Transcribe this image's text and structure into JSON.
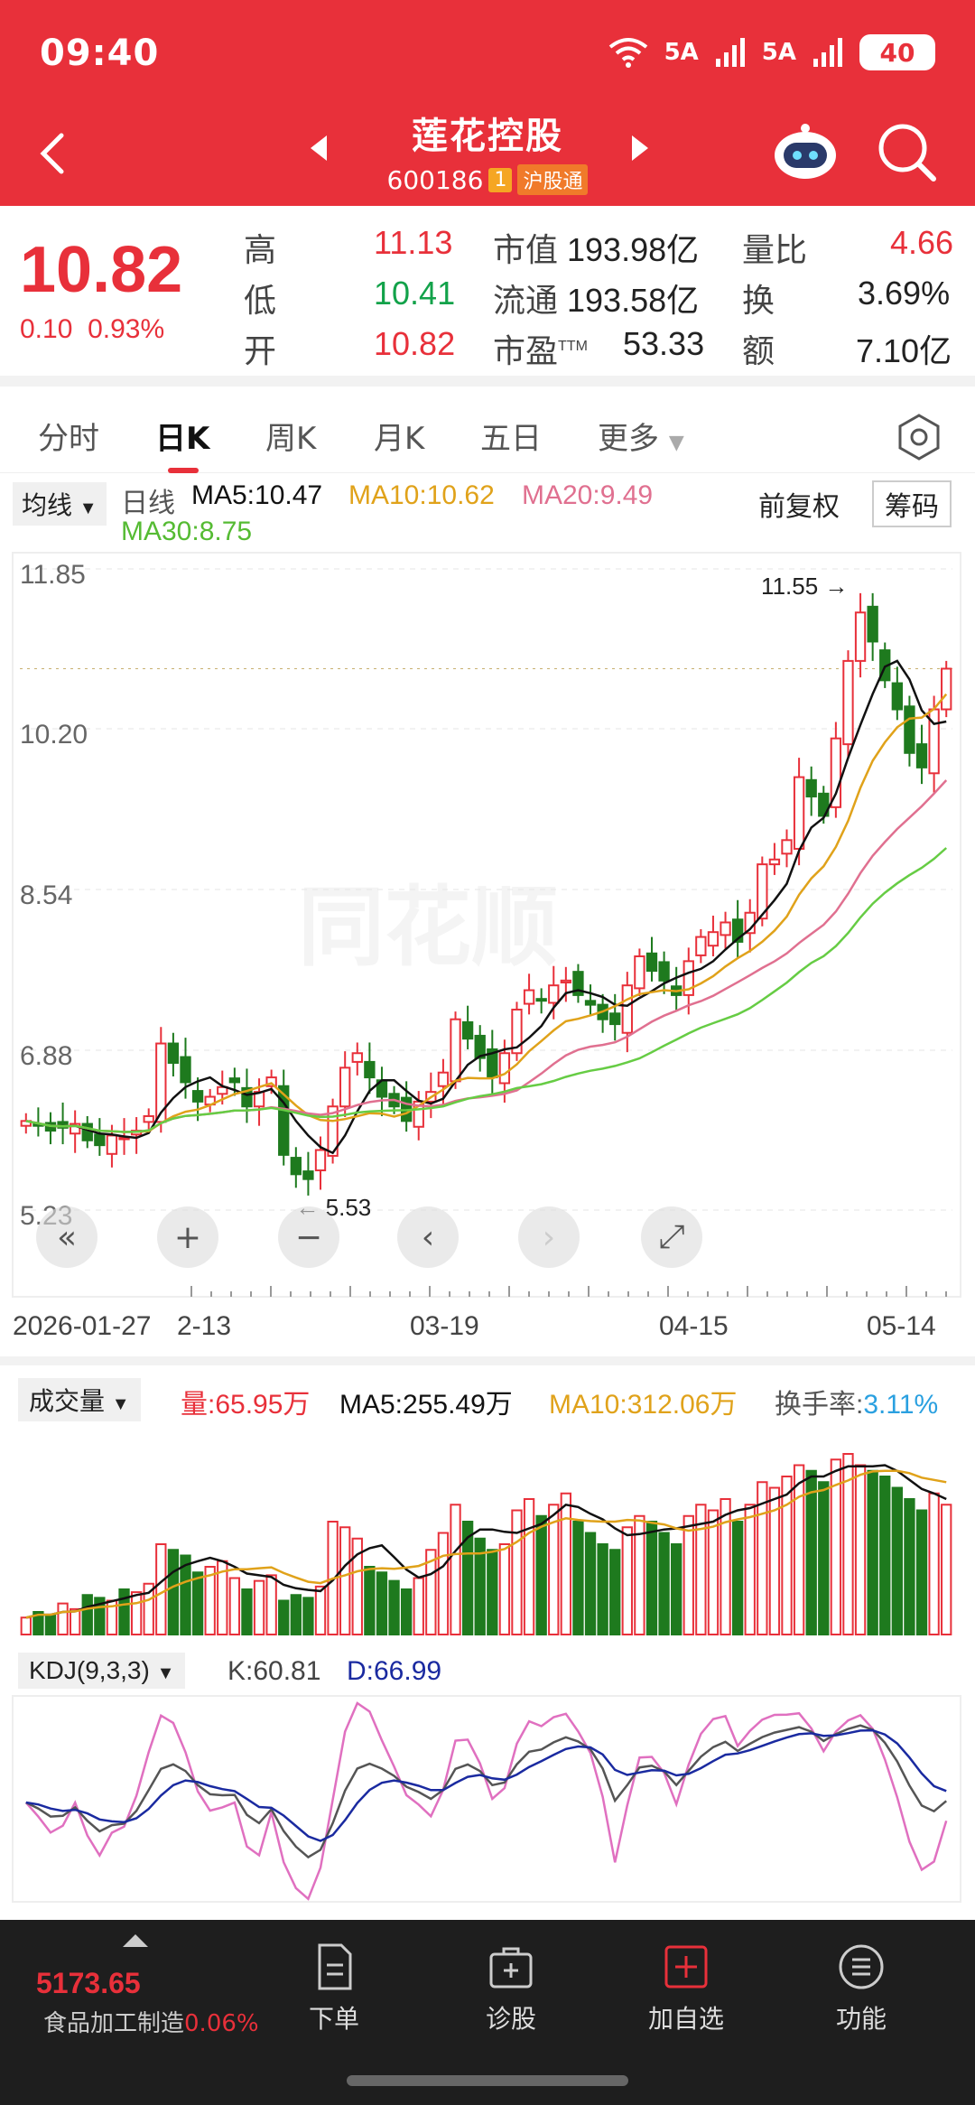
{
  "status": {
    "time": "09:40",
    "signal1": "5A",
    "signal2": "5A",
    "battery": "40"
  },
  "header": {
    "name": "莲花控股",
    "code": "600186",
    "badge_num": "1",
    "badge_text": "沪股通"
  },
  "quote": {
    "price": "10.82",
    "change": "0.10",
    "change_pct": "0.93%",
    "high_label": "高",
    "high": "11.13",
    "low_label": "低",
    "low": "10.41",
    "open_label": "开",
    "open": "10.82",
    "mktcap_label": "市值",
    "mktcap": "193.98亿",
    "float_label": "流通",
    "float": "193.58亿",
    "pe_label": "市盈",
    "pe_sup": "TTM",
    "pe": "53.33",
    "volratio_label": "量比",
    "volratio": "4.66",
    "turnover_label": "换",
    "turnover": "3.69%",
    "amount_label": "额",
    "amount": "7.10亿"
  },
  "tabs": [
    {
      "label": "分时"
    },
    {
      "label": "日K"
    },
    {
      "label": "周K"
    },
    {
      "label": "月K"
    },
    {
      "label": "五日"
    },
    {
      "label": "更多"
    }
  ],
  "ma": {
    "select": "均线",
    "period": "日线",
    "ma5": "MA5:10.47",
    "ma10": "MA10:10.62",
    "ma20": "MA20:9.49",
    "ma30": "MA30:8.75",
    "fuquan": "前复权",
    "chouma": "筹码"
  },
  "chart_data": {
    "type": "candlestick",
    "y_ticks": [
      "11.85",
      "10.20",
      "8.54",
      "6.88",
      "5.23"
    ],
    "ylim": [
      5.23,
      11.85
    ],
    "annotations": {
      "high": "11.55",
      "low": "5.53"
    },
    "x_ticks": [
      "2026-01-27",
      "2-13",
      "03-19",
      "04-15",
      "05-14"
    ],
    "colors": {
      "up": "#e8303a",
      "down": "#1e7a1e",
      "ma5": "#111111",
      "ma10": "#e0a21a",
      "ma20": "#e07090",
      "ma30": "#66cc44"
    },
    "closes": [
      6.15,
      6.1,
      6.05,
      6.08,
      6.12,
      5.95,
      5.9,
      6.0,
      5.98,
      6.05,
      6.2,
      6.95,
      6.75,
      6.55,
      6.35,
      6.4,
      6.5,
      6.55,
      6.3,
      6.45,
      6.6,
      5.8,
      5.6,
      5.55,
      5.85,
      6.3,
      6.7,
      6.85,
      6.6,
      6.4,
      6.3,
      6.15,
      6.35,
      6.45,
      6.65,
      7.2,
      7.0,
      6.8,
      6.6,
      6.85,
      7.3,
      7.5,
      7.4,
      7.55,
      7.6,
      7.45,
      7.35,
      7.2,
      7.15,
      7.55,
      7.85,
      7.7,
      7.6,
      7.45,
      7.8,
      8.05,
      8.1,
      8.2,
      8.0,
      8.3,
      8.8,
      8.85,
      9.05,
      9.7,
      9.5,
      9.3,
      10.1,
      10.9,
      11.4,
      11.1,
      10.7,
      10.4,
      9.95,
      9.8,
      10.4,
      10.82
    ]
  },
  "controls": {
    "rewind": "«",
    "zoom_in": "+",
    "zoom_out": "−",
    "prev": "‹",
    "next": "›",
    "fullscreen": "⤢"
  },
  "volume": {
    "select": "成交量",
    "vol": "量:65.95万",
    "ma5": "MA5:255.49万",
    "ma10": "MA10:312.06万",
    "turnover_label": "换手率:",
    "turnover": "3.11%",
    "bars": [
      30,
      40,
      35,
      55,
      45,
      70,
      65,
      60,
      80,
      75,
      90,
      160,
      150,
      140,
      110,
      120,
      130,
      100,
      80,
      95,
      105,
      60,
      70,
      65,
      85,
      200,
      190,
      170,
      120,
      110,
      95,
      80,
      100,
      150,
      180,
      230,
      200,
      170,
      150,
      160,
      220,
      240,
      210,
      230,
      250,
      200,
      180,
      160,
      150,
      190,
      210,
      200,
      180,
      160,
      210,
      230,
      220,
      240,
      200,
      230,
      270,
      260,
      280,
      300,
      290,
      270,
      310,
      320,
      300,
      290,
      280,
      260,
      240,
      220,
      250,
      230
    ]
  },
  "kdj": {
    "select": "KDJ(9,3,3)",
    "k": "K:60.81",
    "d": "D:66.99"
  },
  "bottom": {
    "index_val": "5173.65",
    "index_name": "食品加工制造",
    "index_pct": "0.06%",
    "items": [
      {
        "label": "下单"
      },
      {
        "label": "诊股"
      },
      {
        "label": "加自选"
      },
      {
        "label": "功能"
      }
    ]
  }
}
